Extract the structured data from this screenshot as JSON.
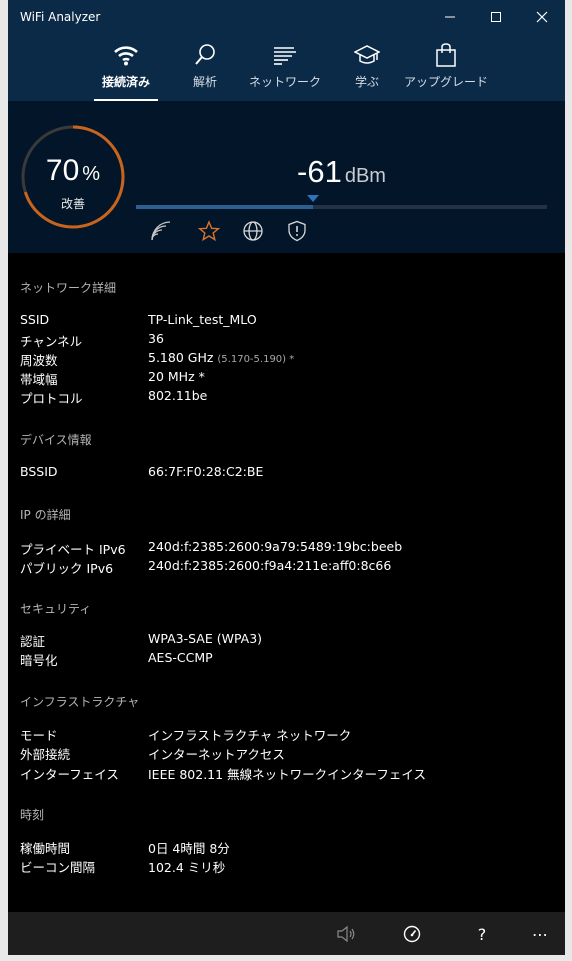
{
  "app": {
    "title": "WiFi Analyzer"
  },
  "nav": {
    "items": [
      {
        "label": "接続済み",
        "icon": "wifi-icon",
        "active": true
      },
      {
        "label": "解析",
        "icon": "magnifier-icon"
      },
      {
        "label": "ネットワーク",
        "icon": "network-list-icon"
      },
      {
        "label": "学ぶ",
        "icon": "graduation-cap-icon"
      },
      {
        "label": "アップグレード",
        "icon": "shopping-bag-icon"
      }
    ]
  },
  "header": {
    "gauge": {
      "value": "70",
      "unit": "%",
      "label": "改善",
      "fraction": 0.7,
      "color": "#c8641e"
    },
    "signal": {
      "value": "-61",
      "unit": "dBm",
      "level_fraction": 0.43,
      "color": "#2f74bb"
    },
    "icons": [
      "wifi-signal-icon",
      "star-icon",
      "globe-icon",
      "shield-icon"
    ]
  },
  "sections": {
    "network": {
      "title": "ネットワーク詳細",
      "rows": [
        {
          "label": "SSID",
          "value": "TP-Link_test_MLO"
        },
        {
          "label": "チャンネル",
          "value": "36"
        },
        {
          "label": "周波数",
          "value": "5.180 GHz",
          "sub": "(5.170-5.190) *"
        },
        {
          "label": "帯域幅",
          "value": "20 MHz *"
        },
        {
          "label": "プロトコル",
          "value": "802.11be"
        }
      ]
    },
    "device": {
      "title": "デバイス情報",
      "rows": [
        {
          "label": "BSSID",
          "value": "66:7F:F0:28:C2:BE"
        }
      ]
    },
    "ip": {
      "title": "IP の詳細",
      "rows": [
        {
          "label": "プライベート IPv6",
          "value": "240d:f:2385:2600:9a79:5489:19bc:beeb"
        },
        {
          "label": "パブリック IPv6",
          "value": "240d:f:2385:2600:f9a4:211e:aff0:8c66"
        }
      ]
    },
    "security": {
      "title": "セキュリティ",
      "rows": [
        {
          "label": "認証",
          "value": "WPA3-SAE (WPA3)"
        },
        {
          "label": "暗号化",
          "value": "AES-CCMP"
        }
      ]
    },
    "infra": {
      "title": "インフラストラクチャ",
      "rows": [
        {
          "label": "モード",
          "value": "インフラストラクチャ ネットワーク"
        },
        {
          "label": "外部接続",
          "value": "インターネットアクセス"
        },
        {
          "label": "インターフェイス",
          "value": "IEEE 802.11 無線ネットワークインターフェイス"
        }
      ]
    },
    "time": {
      "title": "時刻",
      "rows": [
        {
          "label": "稼働時間",
          "value": "0日 4時間 8分"
        },
        {
          "label": "ビーコン間隔",
          "value": "102.4 ミリ秒"
        }
      ]
    }
  },
  "bottombar": {
    "icons": [
      "speaker-icon",
      "speedometer-icon",
      "help-icon",
      "more-icon"
    ],
    "help_glyph": "?",
    "more_glyph": "⋯"
  }
}
